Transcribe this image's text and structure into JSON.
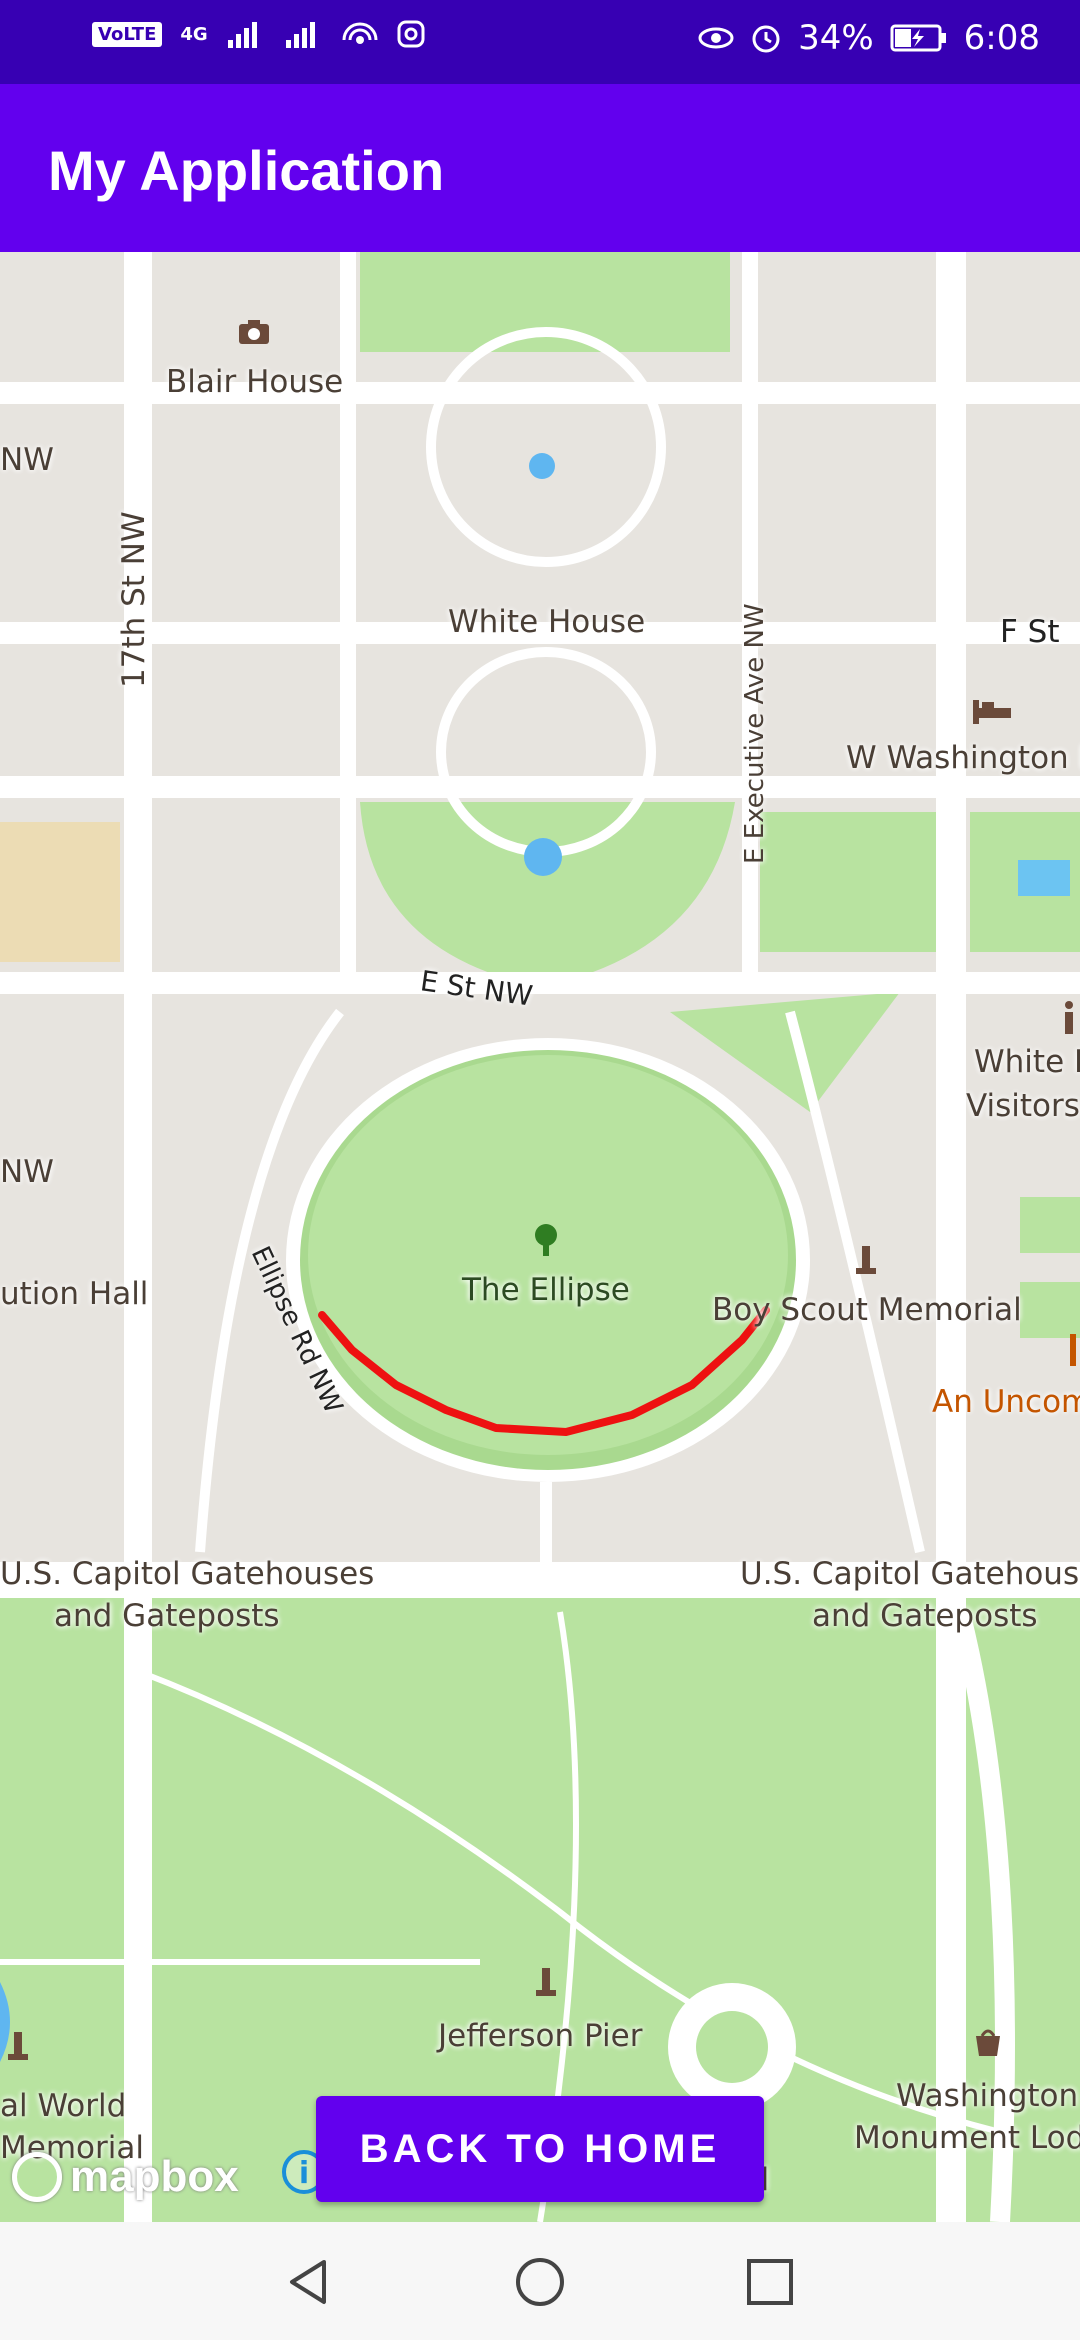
{
  "status_bar": {
    "network_badge": "VoLTE",
    "network_type": "4G",
    "battery": "34%",
    "time": "6:08"
  },
  "app_bar": {
    "title": "My Application"
  },
  "map": {
    "labels": {
      "blair_house": "Blair House",
      "white_house": "White House",
      "seventeenth_st": "17th St NW",
      "e_executive_ave": "E Executive Ave NW",
      "f_st": "F St",
      "w_washington": "W Washington D",
      "e_st": "E St NW",
      "white_house_visitors_1": "White H",
      "white_house_visitors_2": "Visitors",
      "ellipse_rd": "Ellipse Rd NW",
      "the_ellipse": "The Ellipse",
      "boy_scout": "Boy Scout Memorial",
      "constitution_hall": "ution Hall",
      "nw_left_1": "NW",
      "nw_left_2": "NW",
      "an_uncom": "An Uncom",
      "gatehouses_left_1": "U.S. Capitol Gatehouses",
      "gatehouses_left_2": "and Gateposts",
      "gatehouses_right_1": "U.S. Capitol Gatehouse",
      "gatehouses_right_2": "and Gateposts",
      "jefferson_pier": "Jefferson Pier",
      "world_memorial_1": "al World",
      "world_memorial_2": "Memorial",
      "washington_monument_1": "Washington",
      "washington_monument_2": "Monument Lod",
      "partial_ll": "ll"
    },
    "route_color": "#ee1111",
    "park_color": "#b8e3a0",
    "road_color": "#ffffff",
    "attribution": "mapbox"
  },
  "button": {
    "back_label": "BACK TO HOME"
  },
  "colors": {
    "status_bar": "#3700b3",
    "app_bar": "#6200ee"
  }
}
